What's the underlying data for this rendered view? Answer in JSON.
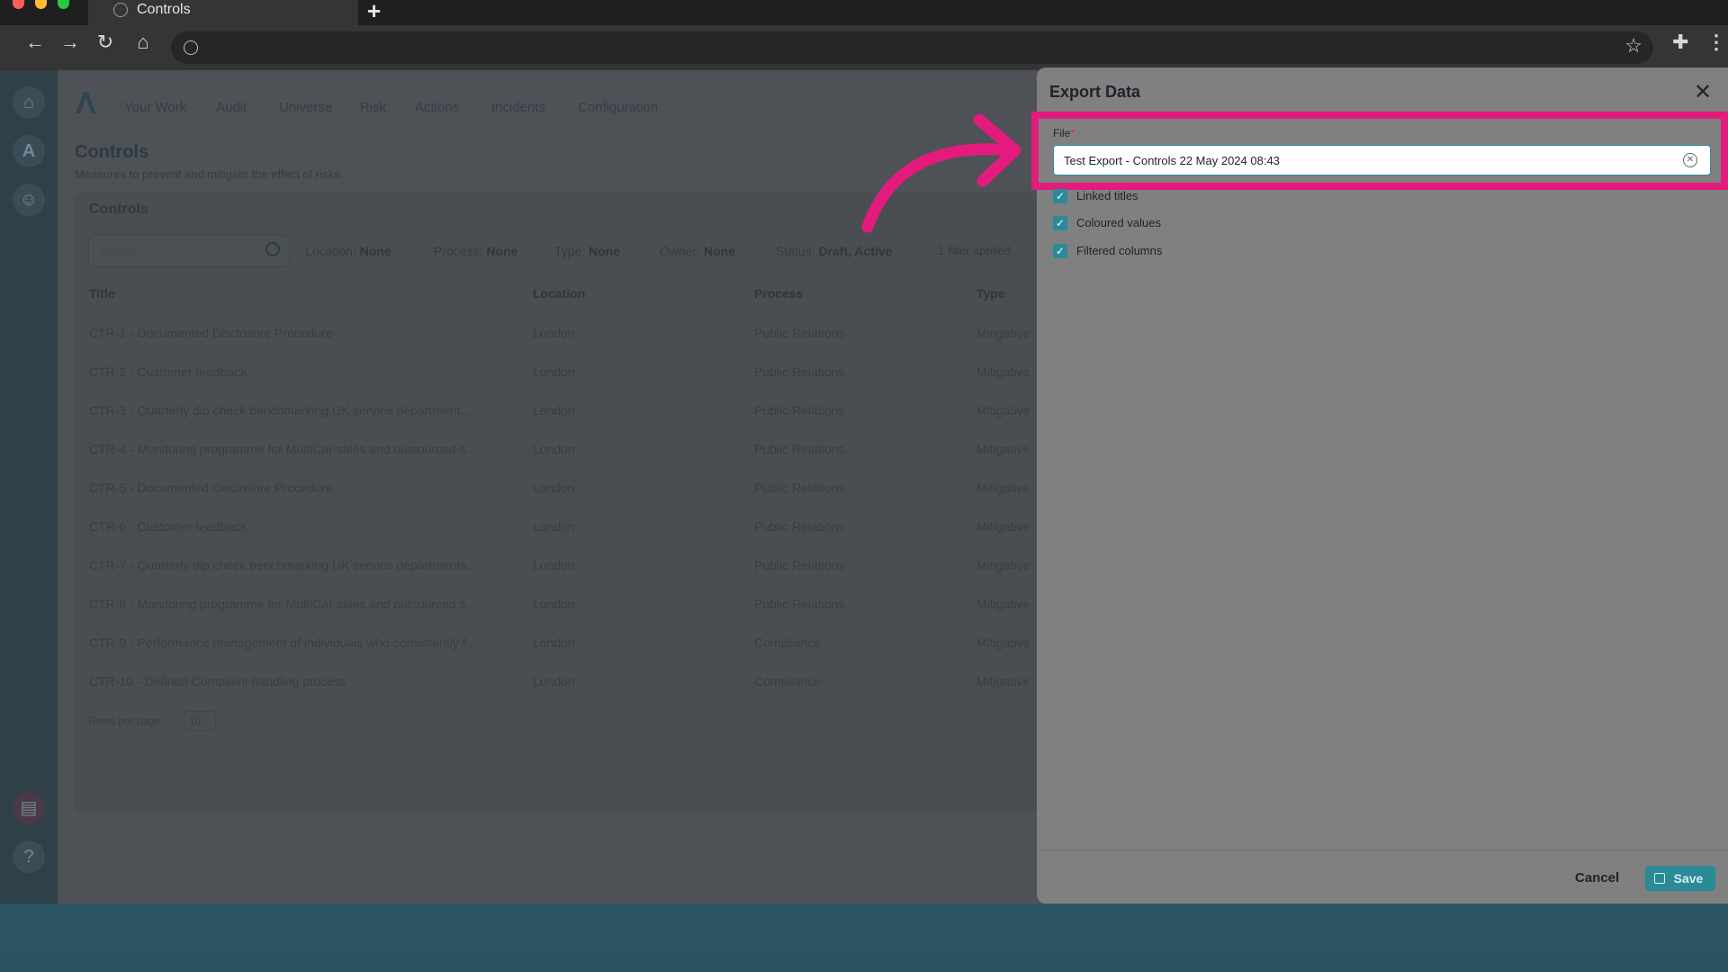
{
  "browser": {
    "tab_title": "Controls",
    "new_tab_symbol": "+",
    "traffic_colors": [
      "#ff5f57",
      "#febc2e",
      "#28c840"
    ]
  },
  "app": {
    "nav_menu": [
      "Your Work",
      "Audit",
      "Universe",
      "Risk",
      "Actions",
      "Incidents",
      "Configuration"
    ],
    "page_title": "Controls",
    "page_subtitle": "Measures to prevent and mitigate the effect of risks.",
    "card_title": "Controls",
    "search_placeholder": "Search",
    "filters": [
      {
        "label": "Location:",
        "value": "None"
      },
      {
        "label": "Process:",
        "value": "None"
      },
      {
        "label": "Type:",
        "value": "None"
      },
      {
        "label": "Owner:",
        "value": "None"
      },
      {
        "label": "Status:",
        "value": "Draft, Active"
      }
    ],
    "filter_count": "1 filter applied",
    "columns": [
      "Title",
      "Location",
      "Process",
      "Type"
    ],
    "rows": [
      {
        "title": "CTR-1 - Documented Disclosure Procedure",
        "location": "London",
        "process": "Public Relations",
        "type": "Mitigative"
      },
      {
        "title": "CTR-2 - Customer feedback",
        "location": "London",
        "process": "Public Relations",
        "type": "Mitigative"
      },
      {
        "title": "CTR-3 - Quarterly dip check benchmarking UK service department...",
        "location": "London",
        "process": "Public Relations",
        "type": "Mitigative"
      },
      {
        "title": "CTR-4 - Monitoring programme for MultiCar sales and outsourced s...",
        "location": "London",
        "process": "Public Relations",
        "type": "Mitigative"
      },
      {
        "title": "CTR-5 - Documented Disclosure Procedure",
        "location": "London",
        "process": "Public Relations",
        "type": "Mitigative"
      },
      {
        "title": "CTR-6 - Customer feedback",
        "location": "London",
        "process": "Public Relations",
        "type": "Mitigative"
      },
      {
        "title": "CTR-7 - Quarterly dip check benchmarking UK service departments...",
        "location": "London",
        "process": "Public Relations",
        "type": "Mitigative"
      },
      {
        "title": "CTR-8 - Monitoring programme for MultiCar sales and outsourced s...",
        "location": "London",
        "process": "Public Relations",
        "type": "Mitigative"
      },
      {
        "title": "CTR-9 - Performance management of individuals who consistently f...",
        "location": "London",
        "process": "Compliance",
        "type": "Mitigative"
      },
      {
        "title": "CTR-10 - Defined Complaint handling process",
        "location": "London",
        "process": "Compliance",
        "type": "Mitigative"
      }
    ],
    "rows_per_page_label": "Rows per page:",
    "rows_per_page_value": "10"
  },
  "drawer": {
    "title": "Export Data",
    "file_label": "File",
    "required_marker": "*",
    "file_value": "Test Export - Controls 22 May 2024 08:43",
    "options": [
      {
        "label": "Linked titles",
        "checked": true
      },
      {
        "label": "Coloured values",
        "checked": true
      },
      {
        "label": "Filtered columns",
        "checked": true
      }
    ],
    "cancel_label": "Cancel",
    "save_label": "Save"
  },
  "annotation": {
    "highlight_color": "#e31b7c"
  }
}
